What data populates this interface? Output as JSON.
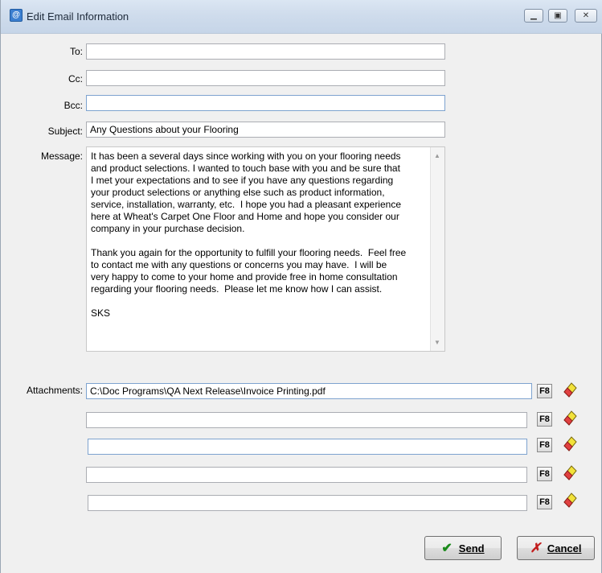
{
  "window": {
    "title": "Edit Email Information"
  },
  "form": {
    "to_label": "To:",
    "to_value": "",
    "cc_label": "Cc:",
    "cc_value": "",
    "bcc_label": "Bcc:",
    "bcc_value": "",
    "subject_label": "Subject:",
    "subject_value": "Any Questions about your Flooring",
    "message_label": "Message:",
    "message_value": "It has been a several days since working with you on your flooring needs\nand product selections. I wanted to touch base with you and be sure that\nI met your expectations and to see if you have any questions regarding\nyour product selections or anything else such as product information,\nservice, installation, warranty, etc.  I hope you had a pleasant experience\nhere at Wheat's Carpet One Floor and Home and hope you consider our\ncompany in your purchase decision.\n\nThank you again for the opportunity to fulfill your flooring needs.  Feel free\nto contact me with any questions or concerns you may have.  I will be\nvery happy to come to your home and provide free in home consultation\nregarding your flooring needs.  Please let me know how I can assist.\n\nSKS",
    "attachments_label": "Attachments:",
    "attachments": [
      "C:\\Doc Programs\\QA Next Release\\Invoice Printing.pdf",
      "",
      "",
      "",
      ""
    ],
    "f8_label": "F8"
  },
  "buttons": {
    "send_label": "Send",
    "cancel_label": "Cancel"
  },
  "icons": {
    "app": "email-icon",
    "browse": "f8-key-icon",
    "clear": "eraser-icon",
    "send": "checkmark-icon",
    "cancel": "x-icon"
  }
}
